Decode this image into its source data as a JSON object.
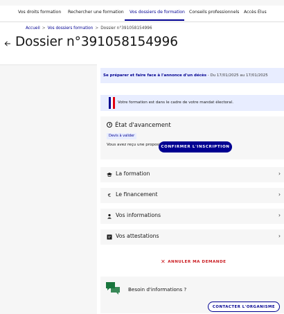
{
  "nav": {
    "items": [
      {
        "label": "Vos droits formation",
        "active": false
      },
      {
        "label": "Rechercher une formation",
        "active": false
      },
      {
        "label": "Vos dossiers de formation",
        "active": true
      },
      {
        "label": "Conseils professionnels",
        "active": false
      },
      {
        "label": "Accès Élus",
        "active": false
      }
    ]
  },
  "breadcrumb": {
    "home": "Accueil",
    "parent": "Vos dossiers formation",
    "separator": ">",
    "current": "Dossier n°391058154996"
  },
  "page": {
    "title": "Dossier n°391058154996",
    "back_icon": "arrow-left-icon"
  },
  "session": {
    "title": "Se préparer et faire face à l'annonce d'un décès",
    "dates": " - Du 17/01/2025 au 17/01/2025"
  },
  "alert": {
    "text": "Votre formation est dans le cadre de votre mandat électoral.",
    "icon": "french-flag-icon"
  },
  "status": {
    "heading": "État d'avancement",
    "badge": "Devis à valider",
    "message": "Vous avez reçu une proposition de l'organisme de formation.",
    "confirm_label": "CONFIRMER L'INSCRIPTION"
  },
  "sections": [
    {
      "label": "La formation",
      "icon": "graduation-cap-icon"
    },
    {
      "label": "Le financement",
      "icon": "euro-icon"
    },
    {
      "label": "Vos informations",
      "icon": "user-icon"
    },
    {
      "label": "Vos attestations",
      "icon": "document-icon"
    }
  ],
  "cancel": {
    "label": "ANNULER MA DEMANDE"
  },
  "help": {
    "title": "Besoin d'informations ?",
    "contact_label": "CONTACTER L'ORGANISME",
    "icon": "chat-bubbles-icon"
  },
  "colors": {
    "primary": "#000091",
    "danger": "#c9191e",
    "info_bg": "#e8edff",
    "card_bg": "#f6f6f6",
    "chat_green": "#18753c"
  }
}
